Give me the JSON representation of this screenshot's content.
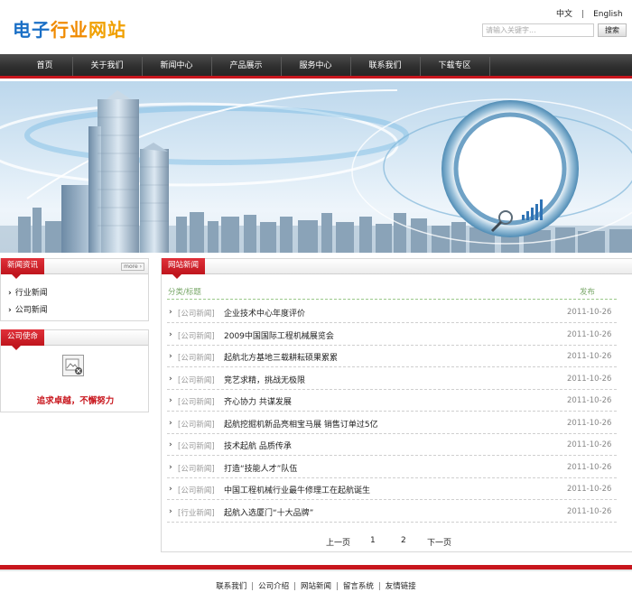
{
  "site": {
    "logo": "电子行业网站",
    "lang_cn": "中文",
    "lang_sep": "|",
    "lang_en": "English",
    "search_placeholder": "请输入关键字...",
    "search_button": "搜索"
  },
  "nav": [
    "首页",
    "关于我们",
    "新闻中心",
    "产品展示",
    "服务中心",
    "联系我们",
    "下载专区"
  ],
  "sidebar": {
    "news_title": "新闻资讯",
    "more_label": "more",
    "news_items": [
      "行业新闻",
      "公司新闻"
    ],
    "mission_title": "公司使命",
    "mission_text": "追求卓越，不懈努力"
  },
  "main": {
    "title": "网站新闻",
    "col_category": "分类/标题",
    "col_date": "发布",
    "rows": [
      {
        "cat": "[公司新闻]",
        "title": "企业技术中心年度评价",
        "date": "2011-10-26"
      },
      {
        "cat": "[公司新闻]",
        "title": "2009中国国际工程机械展览会",
        "date": "2011-10-26"
      },
      {
        "cat": "[公司新闻]",
        "title": "起航北方基地三载耕耘硕果累累",
        "date": "2011-10-26"
      },
      {
        "cat": "[公司新闻]",
        "title": "竞艺求精，挑战无极限",
        "date": "2011-10-26"
      },
      {
        "cat": "[公司新闻]",
        "title": "齐心协力 共谋发展",
        "date": "2011-10-26"
      },
      {
        "cat": "[公司新闻]",
        "title": "起航挖掘机新品亮相宝马展 销售订单过5亿",
        "date": "2011-10-26"
      },
      {
        "cat": "[公司新闻]",
        "title": "技术起航 品质传承",
        "date": "2011-10-26"
      },
      {
        "cat": "[公司新闻]",
        "title": "打造“技能人才”队伍",
        "date": "2011-10-26"
      },
      {
        "cat": "[公司新闻]",
        "title": "中国工程机械行业最牛修理工在起航诞生",
        "date": "2011-10-26"
      },
      {
        "cat": "[行业新闻]",
        "title": "起航入选厦门“十大品牌”",
        "date": "2011-10-26"
      }
    ],
    "pager": {
      "prev": "上一页",
      "p1": "1",
      "p2": "2",
      "next": "下一页"
    }
  },
  "footer": [
    "联系我们",
    "公司介绍",
    "网站新闻",
    "留言系统",
    "友情链接"
  ],
  "footer_sep": "|",
  "colors": {
    "accent": "#c8161d",
    "nav_bg": "#333333"
  }
}
